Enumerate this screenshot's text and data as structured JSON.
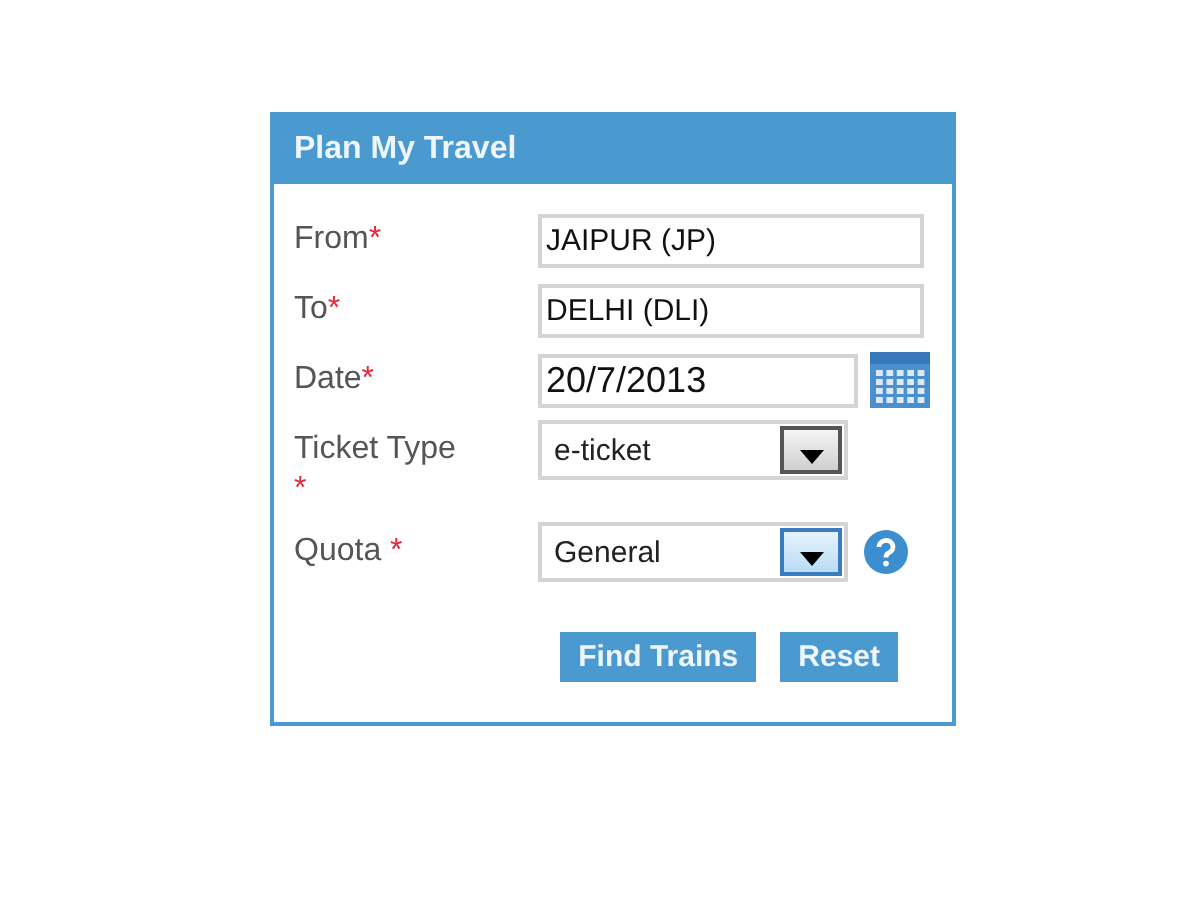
{
  "panel": {
    "title": "Plan My Travel"
  },
  "fields": [
    {
      "kind": "text",
      "label": "From",
      "required_mark": "*",
      "value": "JAIPUR (JP)"
    },
    {
      "kind": "text",
      "label": "To",
      "required_mark": "*",
      "value": "DELHI (DLI)"
    },
    {
      "kind": "date",
      "label": "Date",
      "required_mark": "*",
      "value": "20/7/2013"
    },
    {
      "kind": "select",
      "label": "Ticket Type",
      "required_mark": " *",
      "value": "e-ticket",
      "focused": false
    },
    {
      "kind": "select",
      "label": "Quota",
      "required_mark": " *",
      "value": "General",
      "focused": true,
      "help": true
    }
  ],
  "buttons": [
    {
      "label": "Find Trains"
    },
    {
      "label": "Reset"
    }
  ]
}
